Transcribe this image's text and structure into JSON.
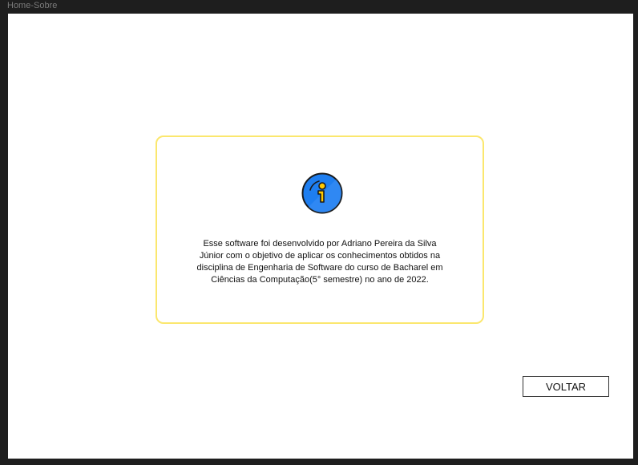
{
  "window": {
    "title": "Home-Sobre"
  },
  "about": {
    "icon": "info-icon",
    "lines": [
      "Esse software foi desenvolvido por Adriano Pereira da Silva",
      "Júnior com o objetivo de aplicar os conhecimentos obtidos na",
      "disciplina de Engenharia de Software do curso de Bacharel em",
      "Ciências da Computação(5° semestre) no ano de 2022."
    ]
  },
  "actions": {
    "back_label": "VOLTAR"
  },
  "colors": {
    "card_border": "#fbe76e",
    "icon_blue": "#1e7ef0",
    "icon_yellow": "#ffc800"
  }
}
